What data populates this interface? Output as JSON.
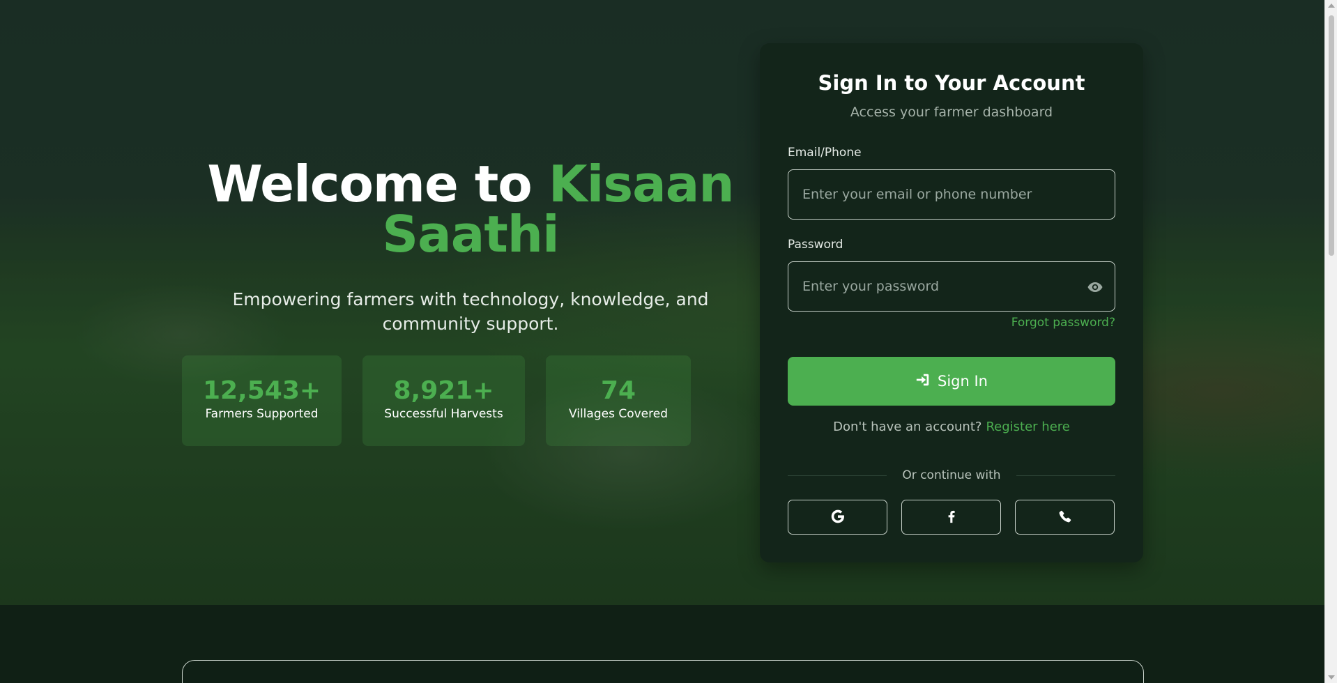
{
  "hero": {
    "title_prefix": "Welcome to ",
    "title_accent": "Kisaan Saathi",
    "subtitle": "Empowering farmers with technology, knowledge, and community support."
  },
  "stats": [
    {
      "value": "12,543+",
      "label": "Farmers Supported"
    },
    {
      "value": "8,921+",
      "label": "Successful Harvests"
    },
    {
      "value": "74",
      "label": "Villages Covered"
    }
  ],
  "signin": {
    "title": "Sign In to Your Account",
    "subtitle": "Access your farmer dashboard",
    "email_label": "Email/Phone",
    "email_placeholder": "Enter your email or phone number",
    "password_label": "Password",
    "password_placeholder": "Enter your password",
    "forgot_link": "Forgot password?",
    "submit_label": "Sign In",
    "no_account_text": "Don't have an account?",
    "register_link": "Register here",
    "divider_text": "Or continue with",
    "social_icons": [
      "google-icon",
      "facebook-icon",
      "phone-icon"
    ]
  },
  "colors": {
    "accent": "#4caf50",
    "card_bg": "#13251a",
    "page_bg": "#0f1f15"
  }
}
